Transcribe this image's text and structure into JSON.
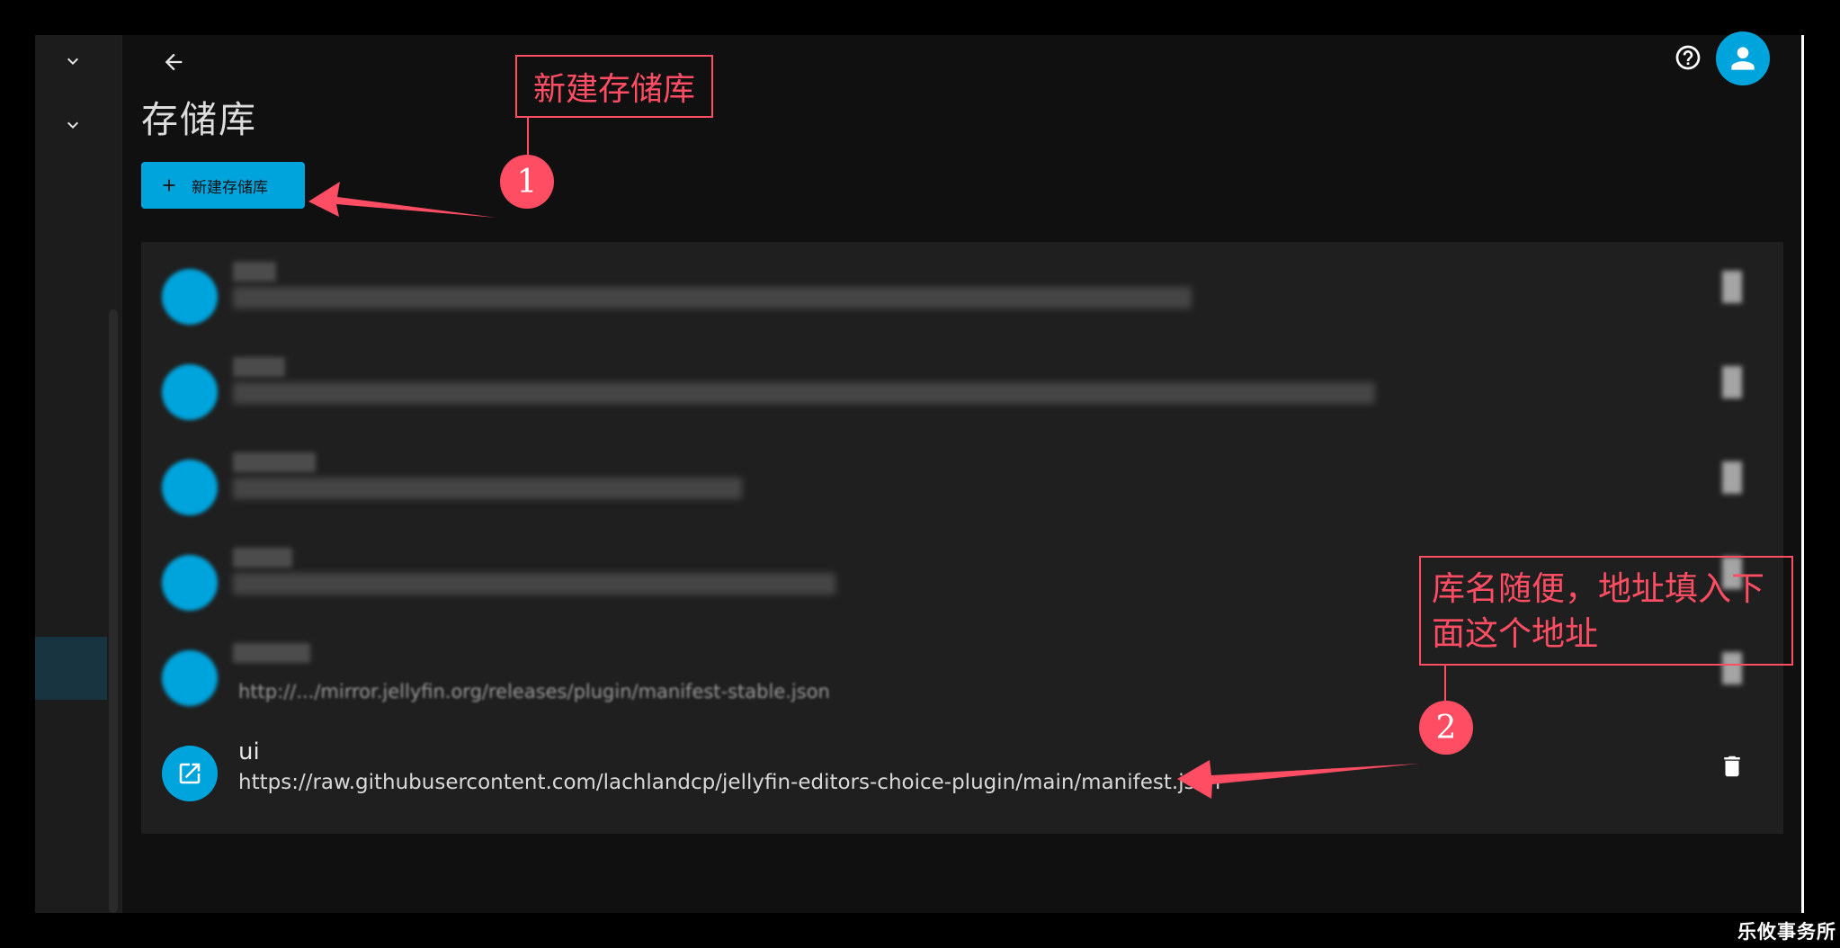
{
  "header": {
    "title": "存储库",
    "back_icon": "arrow-left-icon",
    "help_icon": "help-circle-icon",
    "avatar_icon": "person-icon"
  },
  "sidebar": {
    "icons": [
      "chevron-down-icon",
      "chevron-down-icon"
    ]
  },
  "toolbar": {
    "new_repo_label": "新建存储库",
    "new_repo_icon": "plus-icon"
  },
  "repositories": [
    {
      "name": "",
      "url": "",
      "redacted": true
    },
    {
      "name": "",
      "url": "",
      "redacted": true
    },
    {
      "name": "",
      "url": "",
      "redacted": true
    },
    {
      "name": "",
      "url": "",
      "redacted": true
    },
    {
      "name": "",
      "url": "http://.../mirror.jellyfin.org/releases/plugin/manifest-stable.json",
      "redacted": true
    },
    {
      "name": "ui",
      "url": "https://raw.githubusercontent.com/lachlandcp/jellyfin-editors-choice-plugin/main/manifest.json",
      "redacted": false
    }
  ],
  "annotations": {
    "box1_text": "新建存储库",
    "circle1": "1",
    "box2_line1": "库名随便，地址填入下",
    "box2_line2": "面这个地址",
    "circle2": "2"
  },
  "watermark": "乐攸事务所",
  "colors": {
    "accent": "#00a4dc",
    "annotation": "#ff4d63",
    "background": "#101010",
    "list_background": "#1f1f1f"
  }
}
